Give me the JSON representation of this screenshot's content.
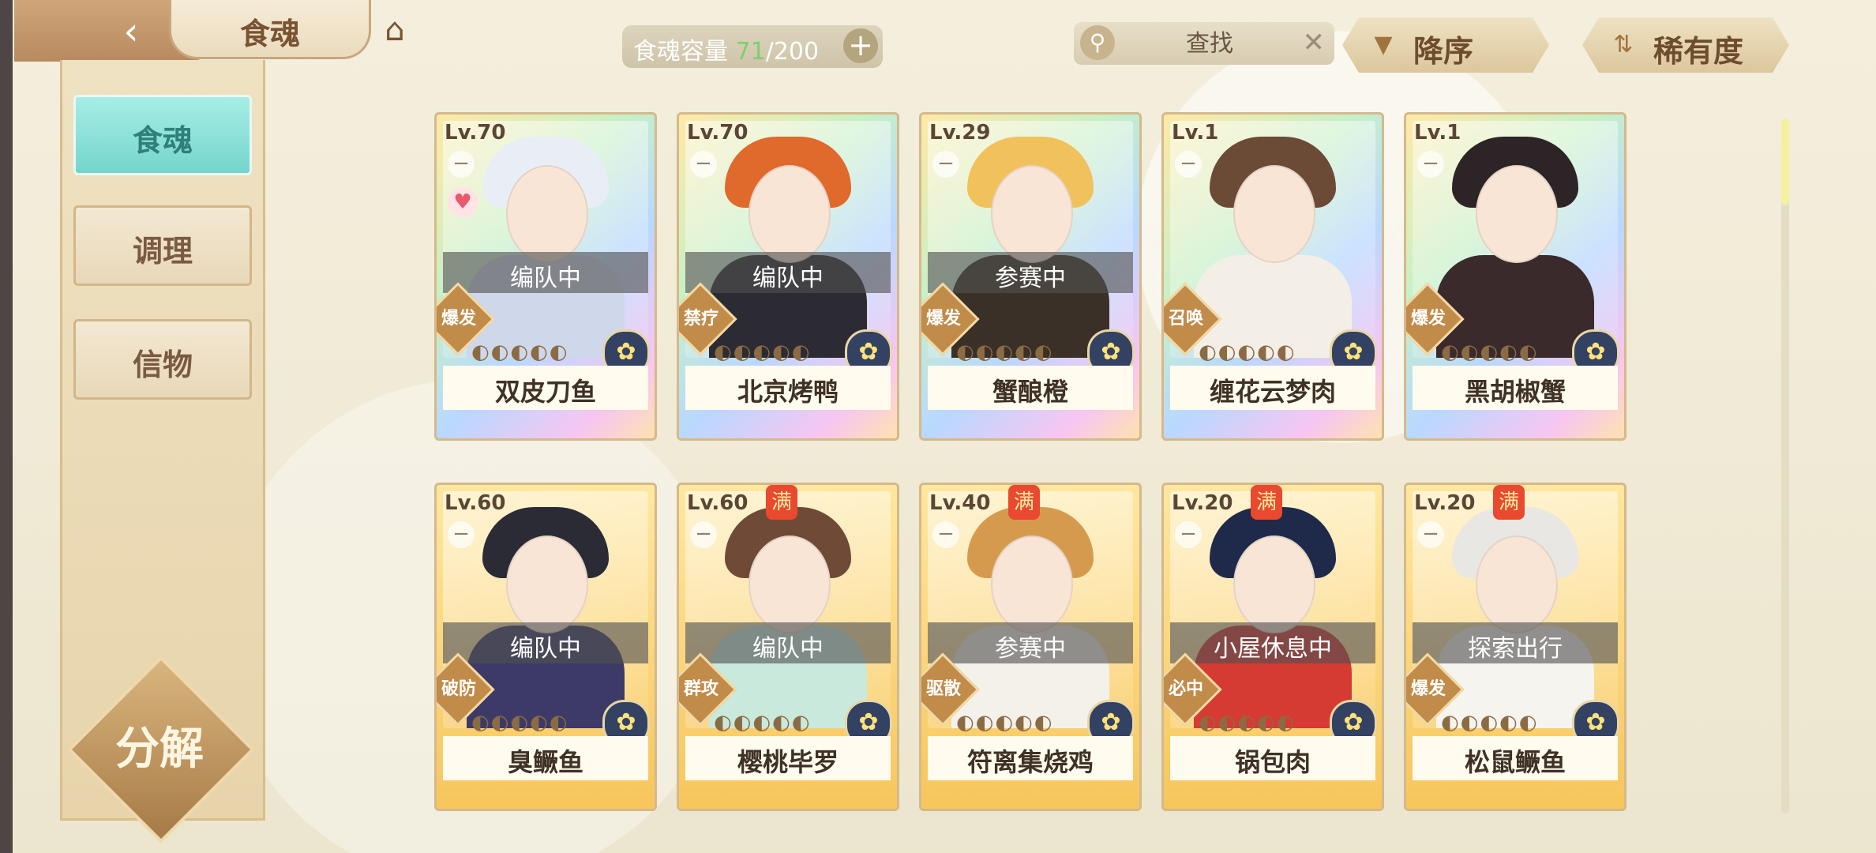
{
  "header": {
    "title": "食魂",
    "capacity_label": "食魂容量",
    "capacity_current": "71",
    "capacity_max": "/200",
    "capacity_add": "+",
    "search_placeholder": "查找",
    "search_clear": "✕",
    "sort_order_label": "降序",
    "sort_field_label": "稀有度"
  },
  "sidebar": {
    "items": [
      {
        "label": "食魂",
        "active": true
      },
      {
        "label": "调理",
        "active": false
      },
      {
        "label": "信物",
        "active": false
      }
    ],
    "decompose_label": "分解"
  },
  "colors": {
    "accent_teal": "#75d5cc",
    "capacity_current": "#7dd16c",
    "max_badge": "#e8492f"
  },
  "cards": [
    {
      "level": "Lv.70",
      "name": "双皮刀鱼",
      "status": "编队中",
      "tag": "爆发",
      "max": "",
      "heart": true,
      "rarity": "rainbow",
      "hair": "#e9eef6",
      "body": "#cfd8ea"
    },
    {
      "level": "Lv.70",
      "name": "北京烤鸭",
      "status": "编队中",
      "tag": "禁疗",
      "max": "",
      "heart": false,
      "rarity": "rainbow",
      "hair": "#e0692c",
      "body": "#2c2b33"
    },
    {
      "level": "Lv.29",
      "name": "蟹酿橙",
      "status": "参赛中",
      "tag": "爆发",
      "max": "",
      "heart": false,
      "rarity": "rainbow",
      "hair": "#f1c15b",
      "body": "#3a3027"
    },
    {
      "level": "Lv.1",
      "name": "缠花云梦肉",
      "status": "",
      "tag": "召唤",
      "max": "",
      "heart": false,
      "rarity": "rainbow",
      "hair": "#6b4a36",
      "body": "#f4efe6"
    },
    {
      "level": "Lv.1",
      "name": "黑胡椒蟹",
      "status": "",
      "tag": "爆发",
      "max": "",
      "heart": false,
      "rarity": "rainbow",
      "hair": "#2d2427",
      "body": "#3a2a2c"
    },
    {
      "level": "Lv.60",
      "name": "臭鳜鱼",
      "status": "编队中",
      "tag": "破防",
      "max": "",
      "heart": false,
      "rarity": "gold",
      "hair": "#2b2b35",
      "body": "#3d3a67"
    },
    {
      "level": "Lv.60",
      "name": "樱桃毕罗",
      "status": "编队中",
      "tag": "群攻",
      "max": "满",
      "heart": false,
      "rarity": "gold",
      "hair": "#6e4a37",
      "body": "#c9e9dd"
    },
    {
      "level": "Lv.40",
      "name": "符离集烧鸡",
      "status": "参赛中",
      "tag": "驱散",
      "max": "满",
      "heart": false,
      "rarity": "gold",
      "hair": "#d69a4f",
      "body": "#f3f1ea"
    },
    {
      "level": "Lv.20",
      "name": "锅包肉",
      "status": "小屋休息中",
      "tag": "必中",
      "max": "满",
      "heart": false,
      "rarity": "gold",
      "hair": "#1f2a4a",
      "body": "#d53b32"
    },
    {
      "level": "Lv.20",
      "name": "松鼠鳜鱼",
      "status": "探索出行",
      "tag": "爆发",
      "max": "满",
      "heart": false,
      "rarity": "gold",
      "hair": "#e9e7e4",
      "body": "#f6f4ef"
    }
  ]
}
